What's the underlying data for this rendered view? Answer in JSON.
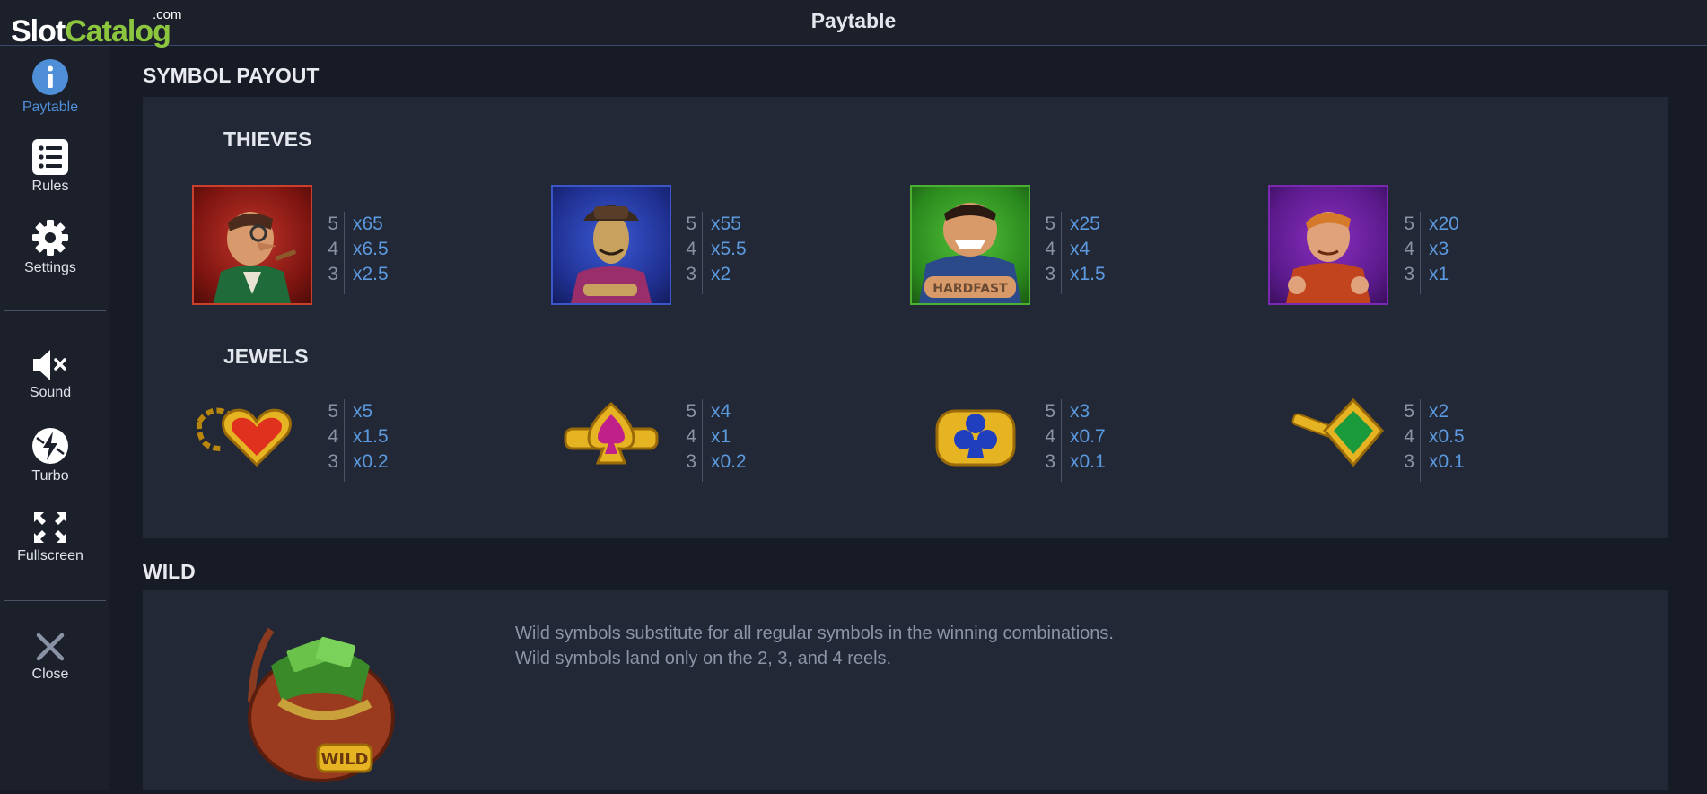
{
  "logo": {
    "part1": "Slot",
    "part2": "Catalog",
    "suffix": ".com"
  },
  "header": {
    "title": "Paytable"
  },
  "sidebar": {
    "items": [
      {
        "label": "Paytable",
        "icon": "info-icon"
      },
      {
        "label": "Rules",
        "icon": "list-icon"
      },
      {
        "label": "Settings",
        "icon": "gear-icon"
      },
      {
        "label": "Sound",
        "icon": "sound-muted-icon"
      },
      {
        "label": "Turbo",
        "icon": "turbo-icon"
      },
      {
        "label": "Fullscreen",
        "icon": "fullscreen-icon"
      },
      {
        "label": "Close",
        "icon": "close-icon"
      }
    ]
  },
  "symbol_payout": {
    "title": "SYMBOL PAYOUT",
    "groups": [
      {
        "title": "THIEVES",
        "symbols": [
          {
            "name": "old-thief",
            "counts": [
              "5",
              "4",
              "3"
            ],
            "payouts": [
              "x65",
              "x6.5",
              "x2.5"
            ]
          },
          {
            "name": "hat-thief",
            "counts": [
              "5",
              "4",
              "3"
            ],
            "payouts": [
              "x55",
              "x5.5",
              "x2"
            ]
          },
          {
            "name": "hard-fist-thief",
            "counts": [
              "5",
              "4",
              "3"
            ],
            "payouts": [
              "x25",
              "x4",
              "x1.5"
            ]
          },
          {
            "name": "young-thief",
            "counts": [
              "5",
              "4",
              "3"
            ],
            "payouts": [
              "x20",
              "x3",
              "x1"
            ]
          }
        ]
      },
      {
        "title": "JEWELS",
        "symbols": [
          {
            "name": "heart-jewel",
            "counts": [
              "5",
              "4",
              "3"
            ],
            "payouts": [
              "x5",
              "x1.5",
              "x0.2"
            ]
          },
          {
            "name": "spade-jewel",
            "counts": [
              "5",
              "4",
              "3"
            ],
            "payouts": [
              "x4",
              "x1",
              "x0.2"
            ]
          },
          {
            "name": "club-jewel",
            "counts": [
              "5",
              "4",
              "3"
            ],
            "payouts": [
              "x3",
              "x0.7",
              "x0.1"
            ]
          },
          {
            "name": "diamond-jewel",
            "counts": [
              "5",
              "4",
              "3"
            ],
            "payouts": [
              "x2",
              "x0.5",
              "x0.1"
            ]
          }
        ]
      }
    ]
  },
  "wild": {
    "title": "WILD",
    "symbol_label": "WILD",
    "text_line1": "Wild symbols substitute for all regular symbols in the winning combinations.",
    "text_line2": "Wild symbols land only on the 2, 3, and 4 reels."
  },
  "colors": {
    "background": "#161b26",
    "panel": "#222835",
    "accent": "#4f8fd8",
    "payout": "#5c9ae0",
    "logo_green": "#8cc63f"
  }
}
